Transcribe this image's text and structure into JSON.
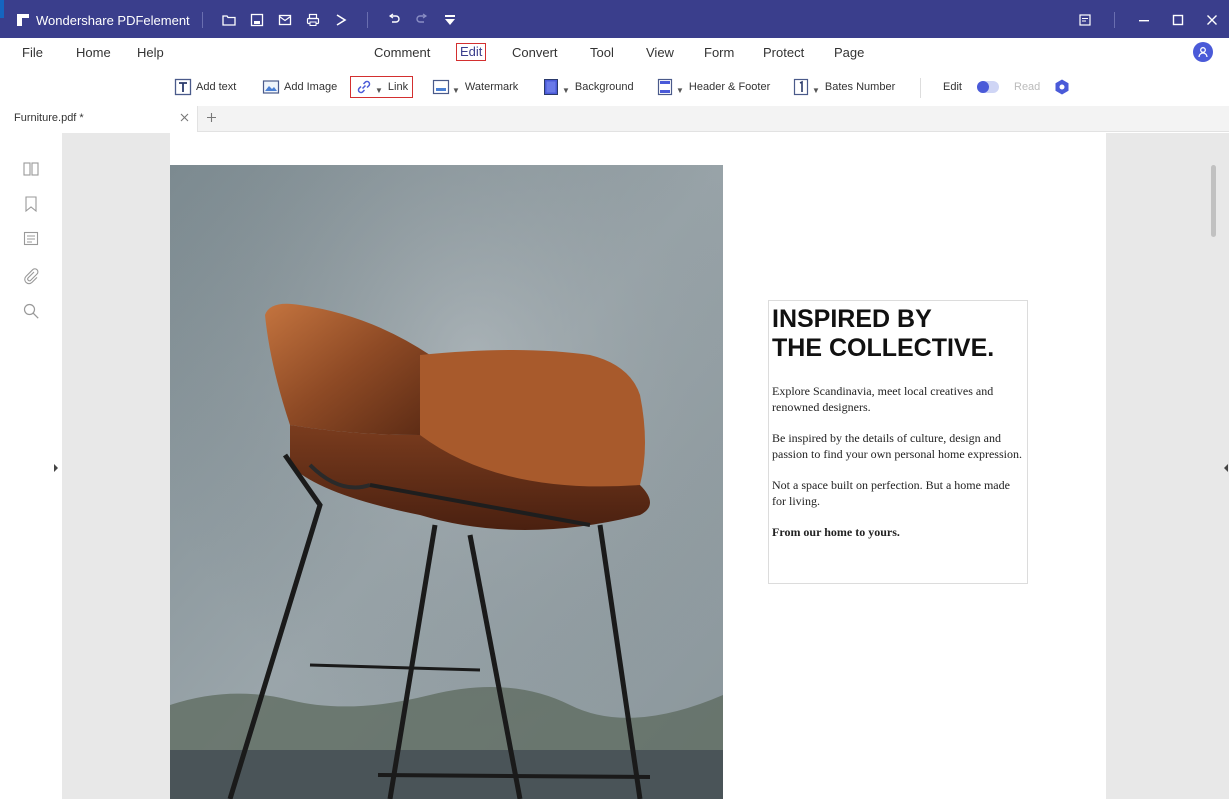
{
  "app": {
    "title": "Wondershare PDFelement",
    "brand_color": "#3a3e8c",
    "quick_access_icons": [
      "open-folder-icon",
      "save-icon",
      "email-icon",
      "print-icon",
      "share-icon",
      "undo-icon",
      "redo-icon",
      "customize-icon"
    ],
    "window_controls": [
      "feedback-icon",
      "minimize-icon",
      "maximize-icon",
      "close-icon"
    ]
  },
  "menu": {
    "file": "File",
    "home": "Home",
    "help": "Help",
    "comment": "Comment",
    "edit": "Edit",
    "convert": "Convert",
    "tool": "Tool",
    "view": "View",
    "form": "Form",
    "protect": "Protect",
    "page": "Page",
    "active": "Edit"
  },
  "toolbar": {
    "add_text": "Add text",
    "add_image": "Add Image",
    "link": "Link",
    "watermark": "Watermark",
    "background": "Background",
    "header_footer": "Header & Footer",
    "bates_number": "Bates Number",
    "mode_edit": "Edit",
    "mode_read": "Read",
    "highlight_color": "#d32f2f"
  },
  "tabs": {
    "document": "Furniture.pdf *"
  },
  "sidebar": {
    "icons": [
      "thumbnails-icon",
      "bookmark-icon",
      "comments-icon",
      "attachment-icon",
      "search-icon"
    ]
  },
  "document": {
    "headline_line1": "INSPIRED BY",
    "headline_line2": "THE COLLECTIVE.",
    "para1": "Explore Scandinavia, meet local creatives and renowned designers.",
    "para2": "Be inspired by the details of culture, design and passion to find your own personal home expression.",
    "para3": "Not a space built on perfection. But a home made for living.",
    "para4": "From our home to yours."
  }
}
